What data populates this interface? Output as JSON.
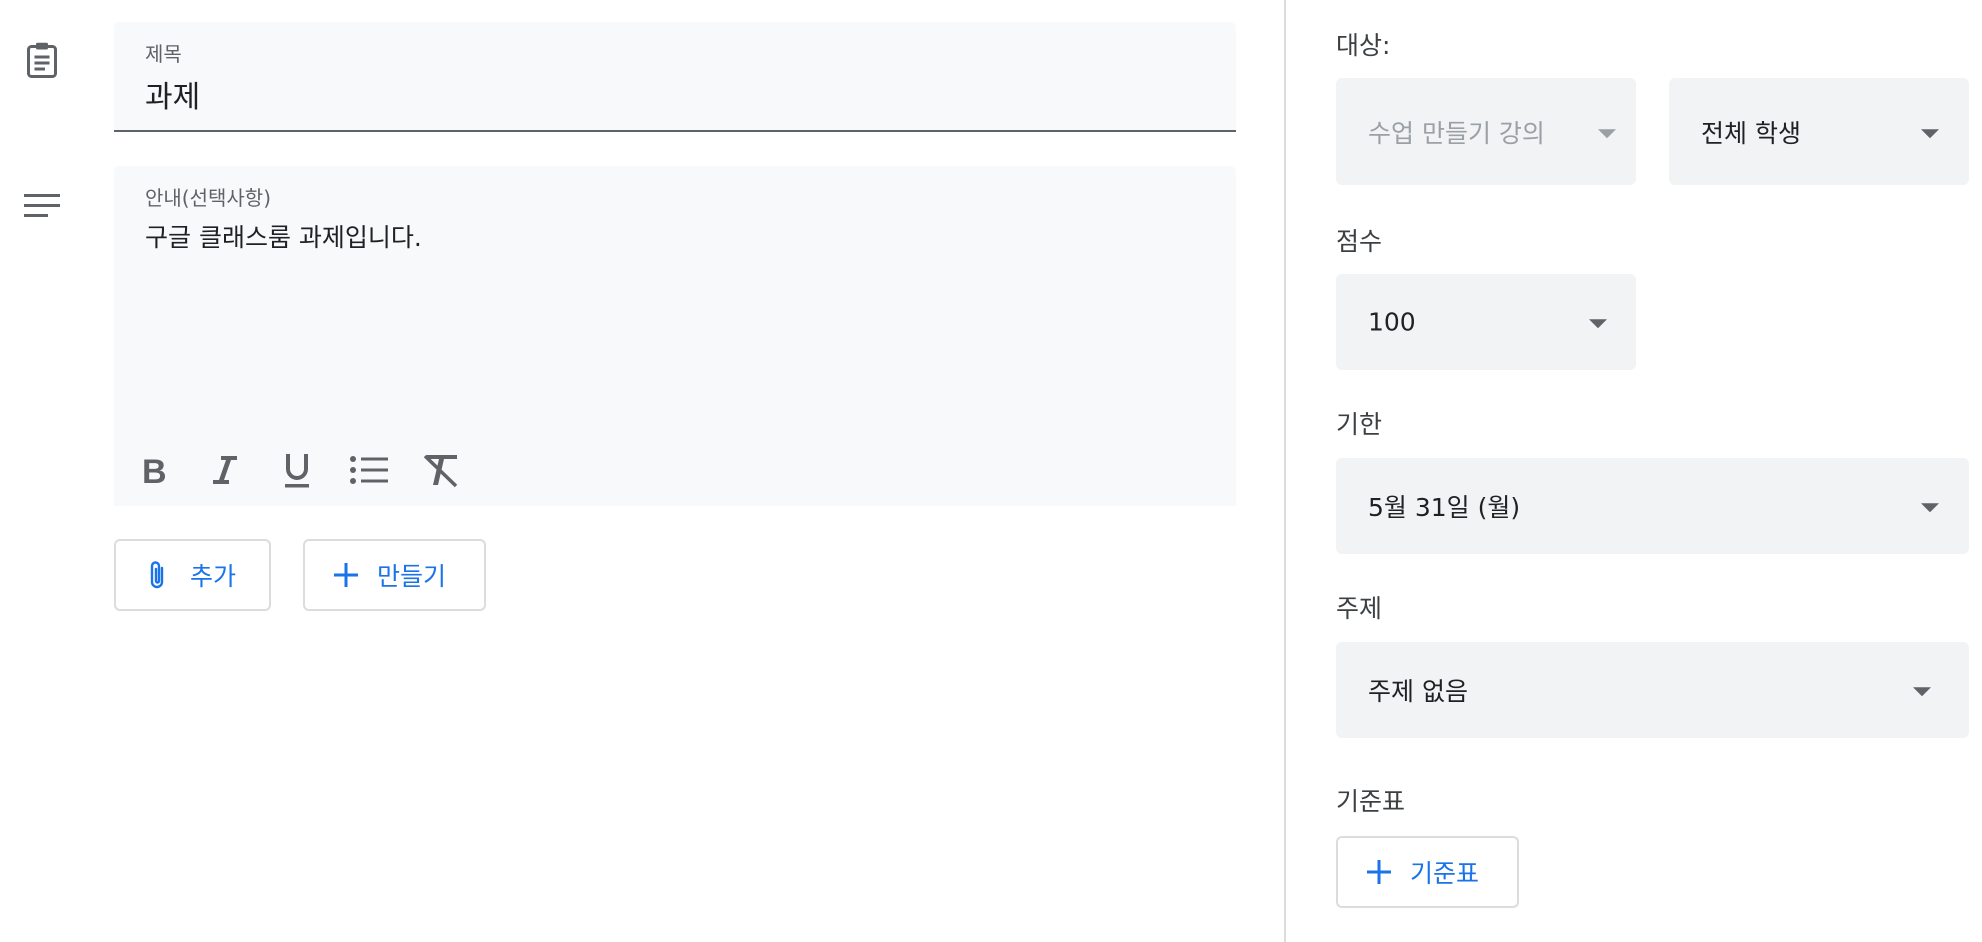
{
  "assignment": {
    "title_label": "제목",
    "title_value": "과제",
    "description_label": "안내(선택사항)",
    "description_value": "구글 클래스룸 과제입니다.",
    "attach_button": "추가",
    "create_button": "만들기"
  },
  "toolbar": {
    "icons": [
      "bold-icon",
      "italic-icon",
      "underline-icon",
      "bulleted-list-icon",
      "clear-formatting-icon"
    ]
  },
  "sidebar": {
    "audience_label": "대상:",
    "class_select": "수업 만들기 강의",
    "students_select": "전체 학생",
    "points_label": "점수",
    "points_value": "100",
    "due_label": "기한",
    "due_value": "5월 31일 (월)",
    "topic_label": "주제",
    "topic_value": "주제 없음",
    "rubric_label": "기준표",
    "rubric_button": "기준표"
  },
  "colors": {
    "accent": "#1a73e8",
    "field_bg": "#f8f9fa",
    "select_bg": "#f1f3f4",
    "icon": "#5f6368"
  }
}
